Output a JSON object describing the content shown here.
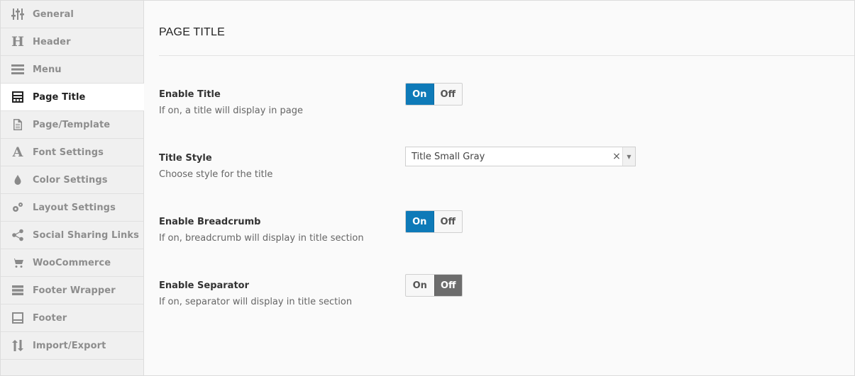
{
  "sidebar": {
    "items": [
      {
        "label": "General",
        "icon": "sliders-icon"
      },
      {
        "label": "Header",
        "icon": "header-h-icon"
      },
      {
        "label": "Menu",
        "icon": "menu-bars-icon"
      },
      {
        "label": "Page Title",
        "icon": "page-title-icon",
        "active": true
      },
      {
        "label": "Page/Template",
        "icon": "document-icon"
      },
      {
        "label": "Font Settings",
        "icon": "font-a-icon"
      },
      {
        "label": "Color Settings",
        "icon": "droplet-icon"
      },
      {
        "label": "Layout Settings",
        "icon": "gears-icon"
      },
      {
        "label": "Social Sharing Links",
        "icon": "share-icon"
      },
      {
        "label": "WooCommerce",
        "icon": "cart-icon"
      },
      {
        "label": "Footer Wrapper",
        "icon": "server-icon"
      },
      {
        "label": "Footer",
        "icon": "footer-icon"
      },
      {
        "label": "Import/Export",
        "icon": "import-export-icon"
      }
    ]
  },
  "main": {
    "section_title": "PAGE TITLE",
    "fields": {
      "enable_title": {
        "label": "Enable Title",
        "description": "If on, a title will display in page",
        "on": "On",
        "off": "Off",
        "value": "on"
      },
      "title_style": {
        "label": "Title Style",
        "description": "Choose style for the title",
        "value": "Title Small Gray",
        "clear": "×",
        "arrow": "▼"
      },
      "enable_breadcrumb": {
        "label": "Enable Breadcrumb",
        "description": "If on, breadcrumb will display in title section",
        "on": "On",
        "off": "Off",
        "value": "on"
      },
      "enable_separator": {
        "label": "Enable Separator",
        "description": "If on, separator will display in title section",
        "on": "On",
        "off": "Off",
        "value": "off"
      }
    }
  },
  "colors": {
    "accent": "#0e7ab8",
    "off_active": "#6c6c6c",
    "sidebar_bg": "#f0f0f0"
  }
}
